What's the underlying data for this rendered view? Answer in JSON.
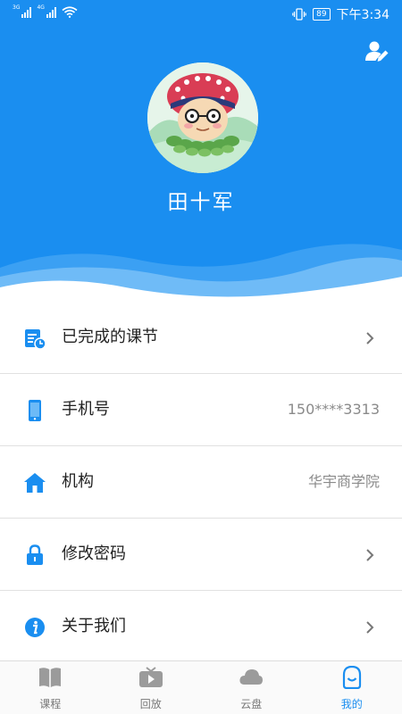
{
  "status_bar": {
    "network_1": "3G",
    "network_2": "4G",
    "battery": "89",
    "time": "下午3:34"
  },
  "profile": {
    "username": "田十军",
    "edit_icon": "edit-profile-icon",
    "avatar_icon": "avatar-cartoon"
  },
  "menu": {
    "items": [
      {
        "label": "已完成的课节",
        "value": "",
        "icon": "completed-lessons-icon",
        "chevron": true
      },
      {
        "label": "手机号",
        "value": "150****3313",
        "icon": "phone-icon",
        "chevron": false
      },
      {
        "label": "机构",
        "value": "华宇商学院",
        "icon": "home-icon",
        "chevron": false
      },
      {
        "label": "修改密码",
        "value": "",
        "icon": "lock-icon",
        "chevron": true
      },
      {
        "label": "关于我们",
        "value": "",
        "icon": "info-icon",
        "chevron": true
      }
    ]
  },
  "tabbar": {
    "tabs": [
      {
        "label": "课程",
        "icon": "book-icon",
        "active": false
      },
      {
        "label": "回放",
        "icon": "tv-icon",
        "active": false
      },
      {
        "label": "云盘",
        "icon": "cloud-icon",
        "active": false
      },
      {
        "label": "我的",
        "icon": "profile-icon",
        "active": true
      }
    ]
  },
  "colors": {
    "primary": "#1a8ef0",
    "text": "#222222",
    "secondary_text": "#8a8a8a",
    "inactive_icon": "#9b9b9b"
  }
}
